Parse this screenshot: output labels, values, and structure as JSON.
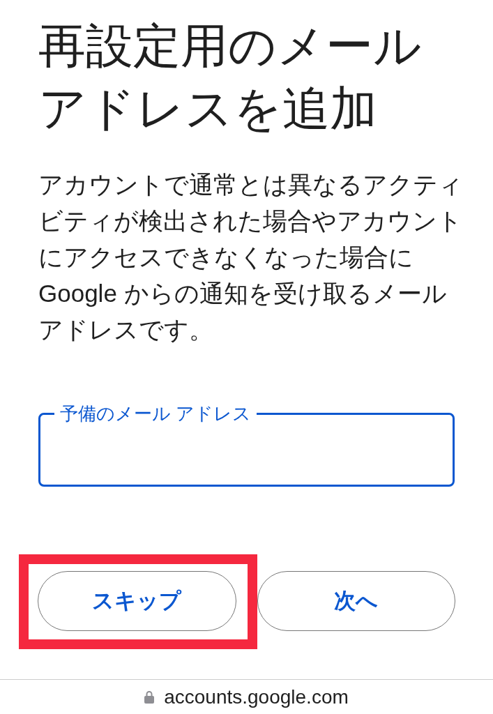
{
  "title": "再設定用のメールアドレスを追加",
  "description": "アカウントで通常とは異なるアクティビティが検出された場合やアカウントにアクセスできなくなった場合に Google からの通知を受け取るメールアドレスです。",
  "email_field": {
    "label": "予備のメール アドレス",
    "focused": true
  },
  "buttons": [
    {
      "label": "スキップ",
      "highlighted": true
    },
    {
      "label": "次へ",
      "highlighted": false
    }
  ],
  "address_bar": {
    "url": "accounts.google.com",
    "secure": true
  }
}
